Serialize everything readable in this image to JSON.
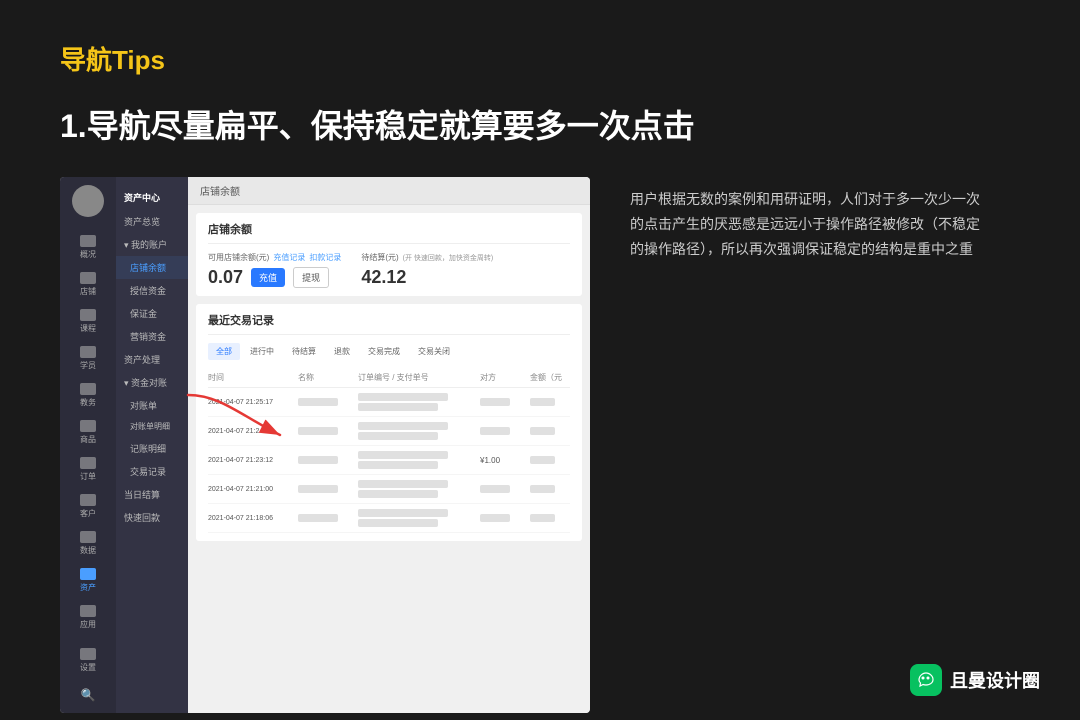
{
  "page": {
    "background_color": "#1a1a1a",
    "nav_tips_title": "导航Tips",
    "main_heading": "1.导航尽量扁平、保持稳定就算要多一次点击"
  },
  "sidebar": {
    "items": [
      {
        "label": "概况",
        "icon": "dashboard-icon",
        "active": false
      },
      {
        "label": "店铺",
        "icon": "shop-icon",
        "active": false
      },
      {
        "label": "课程",
        "icon": "course-icon",
        "active": false
      },
      {
        "label": "学员",
        "icon": "student-icon",
        "active": false
      },
      {
        "label": "教务",
        "icon": "edu-icon",
        "active": false
      },
      {
        "label": "商品",
        "icon": "goods-icon",
        "active": false
      },
      {
        "label": "订单",
        "icon": "order-icon",
        "active": false
      },
      {
        "label": "客户",
        "icon": "customer-icon",
        "active": false
      },
      {
        "label": "数据",
        "icon": "data-icon",
        "active": false
      },
      {
        "label": "资产",
        "icon": "asset-icon",
        "active": true
      }
    ],
    "bottom_items": [
      {
        "label": "应用",
        "icon": "app-icon"
      },
      {
        "label": "设置",
        "icon": "settings-icon"
      }
    ]
  },
  "sub_sidebar": {
    "title": "资产中心",
    "items": [
      {
        "label": "资产总览",
        "active": false,
        "indent": 0
      },
      {
        "label": "我的账户",
        "active": false,
        "indent": 0,
        "expandable": true
      },
      {
        "label": "店铺余额",
        "active": true,
        "indent": 1
      },
      {
        "label": "授信资金",
        "active": false,
        "indent": 1
      },
      {
        "label": "保证金",
        "active": false,
        "indent": 1
      },
      {
        "label": "营销资金",
        "active": false,
        "indent": 1
      },
      {
        "label": "资产处理",
        "active": false,
        "indent": 0
      },
      {
        "label": "资金对账",
        "active": false,
        "indent": 0
      },
      {
        "label": "对账单",
        "active": false,
        "indent": 1
      },
      {
        "label": "对账单明细",
        "active": false,
        "indent": 1
      },
      {
        "label": "记账明细",
        "active": false,
        "indent": 1
      },
      {
        "label": "交易记录",
        "active": false,
        "indent": 1
      },
      {
        "label": "当日结算",
        "active": false,
        "indent": 0
      },
      {
        "label": "快速回款",
        "active": false,
        "indent": 0
      }
    ]
  },
  "content": {
    "breadcrumb": "店铺余额",
    "balance_section_title": "店铺余额",
    "available_label": "可用店铺余额(元)",
    "charge_link": "充值记录",
    "deduction_link": "扣款记录",
    "pending_label": "待结算(元)",
    "pending_hint": "(开 快速回款，加快资金周转)",
    "balance_amount": "0.07",
    "pending_amount": "42.12",
    "charge_btn": "充值",
    "view_btn": "提现",
    "transaction_title": "最近交易记录",
    "tabs": [
      "全部",
      "进行中",
      "待结算",
      "退款",
      "交易完成",
      "交易关闭"
    ],
    "active_tab": "全部",
    "table_headers": [
      "时间",
      "名称",
      "订单编号 / 支付单号",
      "对方",
      "金额（元"
    ],
    "table_rows": [
      {
        "time": "2021-04-07 21:25:17",
        "name": "",
        "order": "",
        "party": "",
        "amount": ""
      },
      {
        "time": "2021-04-07 21:24:19",
        "name": "",
        "order": "",
        "party": "",
        "amount": ""
      },
      {
        "time": "2021-04-07 21:23:12",
        "name": "",
        "order": "",
        "party": "¥1.00",
        "amount": ""
      },
      {
        "time": "2021-04-07 21:21:00",
        "name": "",
        "order": "",
        "party": "",
        "amount": ""
      },
      {
        "time": "2021-04-07 21:18:06",
        "name": "",
        "order": "",
        "party": "",
        "amount": ""
      }
    ]
  },
  "description": {
    "text": "用户根据无数的案例和用研证明，人们对于多一次少一次的点击产生的厌恶感是远远小于操作路径被修改（不稳定的操作路径），所以再次强调保证稳定的结构是重中之重"
  },
  "watermark": {
    "icon_text": "💬",
    "brand_name": "且曼设计圈"
  }
}
